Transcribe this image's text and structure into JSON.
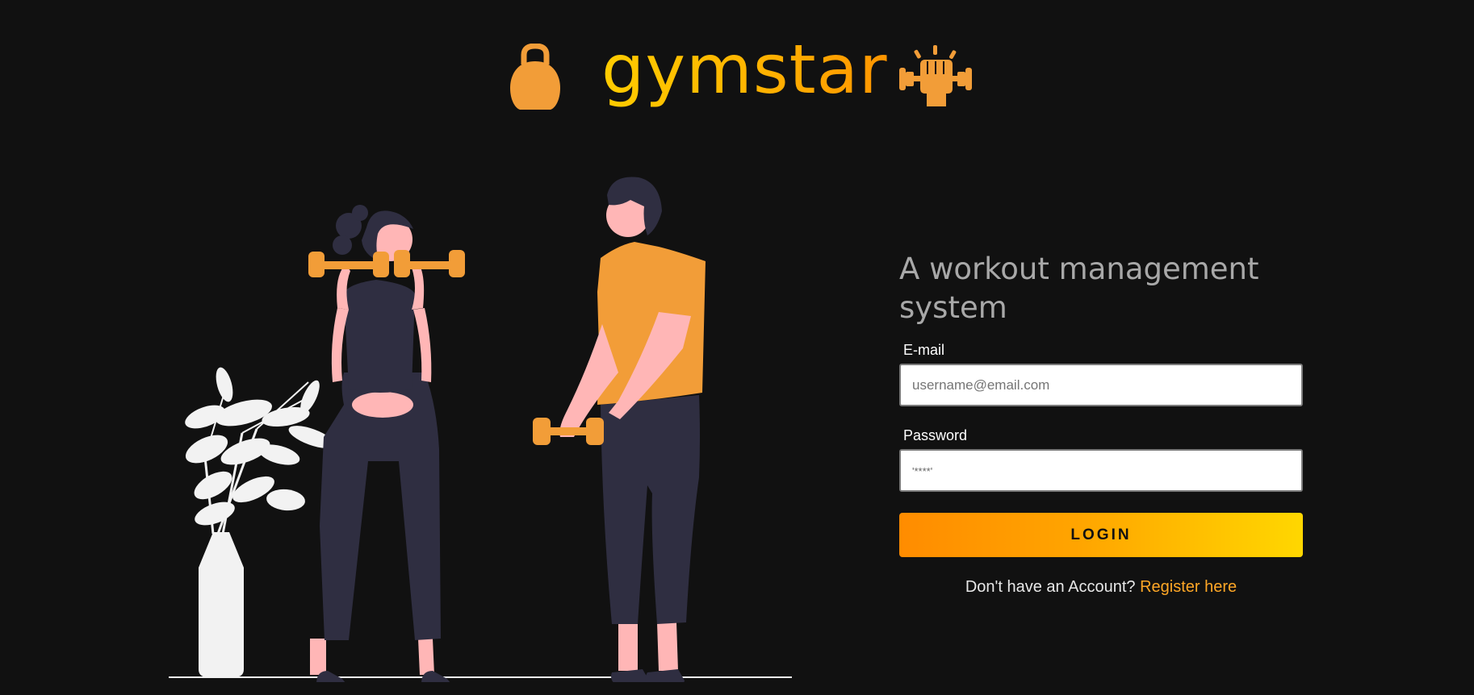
{
  "header": {
    "brand": "gymstar",
    "left_icon": "kettlebell-icon",
    "right_icon": "fist-dumbbell-icon"
  },
  "illustration": {
    "icon": "workout-illustration"
  },
  "login": {
    "tagline": "A workout management system",
    "email_label": "E-mail",
    "email_placeholder": "username@email.com",
    "email_value": "",
    "password_label": "Password",
    "password_placeholder": "'****'",
    "password_value": "",
    "button_label": "LOGIN",
    "register_prompt": "Don't have an Account?",
    "register_link": "Register here"
  },
  "colors": {
    "background": "#111111",
    "accent_orange": "#f29d38",
    "accent_yellow": "#ffcc00",
    "figure_dark": "#2f2e41",
    "skin": "#ffb6b6",
    "plant": "#f2f2f2"
  }
}
